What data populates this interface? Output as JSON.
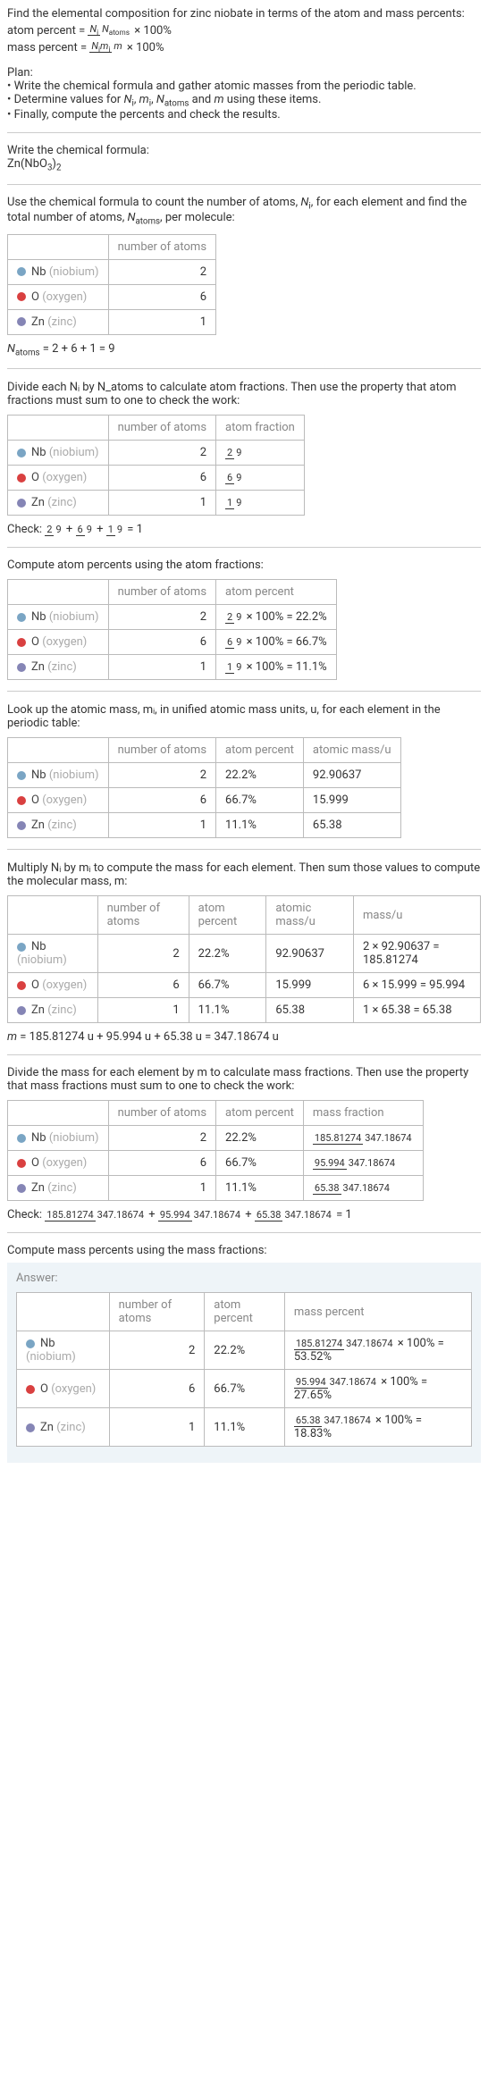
{
  "intro": {
    "line1": "Find the elemental composition for zinc niobate in terms of the atom and mass percents:",
    "atom_percent_formula": "atom percent = (Nᵢ / N_atoms) × 100%",
    "mass_percent_formula": "mass percent = (Nᵢmᵢ / m) × 100%"
  },
  "plan": {
    "heading": "Plan:",
    "bullet1": "• Write the chemical formula and gather atomic masses from the periodic table.",
    "bullet2_prefix": "• Determine values for ",
    "bullet2_vars": "Nᵢ, mᵢ, N_atoms",
    "bullet2_mid": " and ",
    "bullet2_m": "m",
    "bullet2_suffix": " using these items.",
    "bullet3": "• Finally, compute the percents and check the results."
  },
  "formula_section": {
    "heading": "Write the chemical formula:",
    "formula": "Zn(NbO₃)₂"
  },
  "count_section": {
    "text_prefix": "Use the chemical formula to count the number of atoms, ",
    "var_ni": "Nᵢ",
    "text_mid": ", for each element and find the total number of atoms, ",
    "var_natoms": "N_atoms",
    "text_suffix": ", per molecule:",
    "header_count": "number of atoms",
    "nb_label": "Nb",
    "nb_paren": "(niobium)",
    "nb_count": "2",
    "o_label": "O",
    "o_paren": "(oxygen)",
    "o_count": "6",
    "zn_label": "Zn",
    "zn_paren": "(zinc)",
    "zn_count": "1",
    "total": "N_atoms = 2 + 6 + 1 = 9"
  },
  "atom_fraction_section": {
    "text": "Divide each Nᵢ by N_atoms to calculate atom fractions. Then use the property that atom fractions must sum to one to check the work:",
    "header_count": "number of atoms",
    "header_fraction": "atom fraction",
    "nb_count": "2",
    "nb_frac_num": "2",
    "nb_frac_den": "9",
    "o_count": "6",
    "o_frac_num": "6",
    "o_frac_den": "9",
    "zn_count": "1",
    "zn_frac_num": "1",
    "zn_frac_den": "9",
    "check": "Check: 2/9 + 6/9 + 1/9 = 1"
  },
  "atom_percent_section": {
    "text": "Compute atom percents using the atom fractions:",
    "header_count": "number of atoms",
    "header_percent": "atom percent",
    "nb_count": "2",
    "nb_expr": "2/9 × 100% = 22.2%",
    "o_count": "6",
    "o_expr": "6/9 × 100% = 66.7%",
    "zn_count": "1",
    "zn_expr": "1/9 × 100% = 11.1%"
  },
  "atomic_mass_section": {
    "text": "Look up the atomic mass, mᵢ, in unified atomic mass units, u, for each element in the periodic table:",
    "header_count": "number of atoms",
    "header_percent": "atom percent",
    "header_mass": "atomic mass/u",
    "nb_count": "2",
    "nb_pct": "22.2%",
    "nb_mass": "92.90637",
    "o_count": "6",
    "o_pct": "66.7%",
    "o_mass": "15.999",
    "zn_count": "1",
    "zn_pct": "11.1%",
    "zn_mass": "65.38"
  },
  "mass_calc_section": {
    "text": "Multiply Nᵢ by mᵢ to compute the mass for each element. Then sum those values to compute the molecular mass, m:",
    "header_count": "number of atoms",
    "header_percent": "atom percent",
    "header_amass": "atomic mass/u",
    "header_mass": "mass/u",
    "nb_count": "2",
    "nb_pct": "22.2%",
    "nb_amass": "92.90637",
    "nb_mass": "2 × 92.90637 = 185.81274",
    "o_count": "6",
    "o_pct": "66.7%",
    "o_amass": "15.999",
    "o_mass": "6 × 15.999 = 95.994",
    "zn_count": "1",
    "zn_pct": "11.1%",
    "zn_amass": "65.38",
    "zn_mass": "1 × 65.38 = 65.38",
    "total": "m = 185.81274 u + 95.994 u + 65.38 u = 347.18674 u"
  },
  "mass_fraction_section": {
    "text": "Divide the mass for each element by m to calculate mass fractions. Then use the property that mass fractions must sum to one to check the work:",
    "header_count": "number of atoms",
    "header_percent": "atom percent",
    "header_mfrac": "mass fraction",
    "nb_count": "2",
    "nb_pct": "22.2%",
    "nb_frac_num": "185.81274",
    "nb_frac_den": "347.18674",
    "o_count": "6",
    "o_pct": "66.7%",
    "o_frac_num": "95.994",
    "o_frac_den": "347.18674",
    "zn_count": "1",
    "zn_pct": "11.1%",
    "zn_frac_num": "65.38",
    "zn_frac_den": "347.18674",
    "check": "Check: 185.81274/347.18674 + 95.994/347.18674 + 65.38/347.18674 = 1"
  },
  "mass_percent_section": {
    "text": "Compute mass percents using the mass fractions:",
    "answer_label": "Answer:",
    "header_count": "number of atoms",
    "header_percent": "atom percent",
    "header_mpct": "mass percent",
    "nb_count": "2",
    "nb_pct": "22.2%",
    "nb_mpct": "185.81274/347.18674 × 100% = 53.52%",
    "o_count": "6",
    "o_pct": "66.7%",
    "o_mpct": "95.994/347.18674 × 100% = 27.65%",
    "zn_count": "1",
    "zn_pct": "11.1%",
    "zn_mpct": "65.38/347.18674 × 100% = 18.83%"
  }
}
